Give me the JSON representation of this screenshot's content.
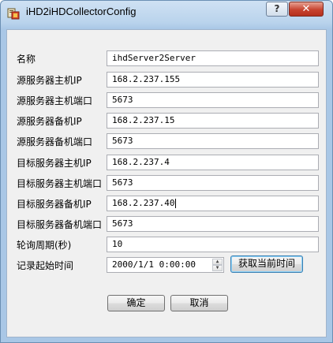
{
  "window": {
    "title": "iHD2iHDCollectorConfig",
    "help_label": "?",
    "close_label": "✕"
  },
  "form": {
    "name": {
      "label": "名称",
      "value": "ihdServer2Server"
    },
    "src_primary_ip": {
      "label": "源服务器主机IP",
      "value": "168.2.237.155"
    },
    "src_primary_port": {
      "label": "源服务器主机端口",
      "value": "5673"
    },
    "src_backup_ip": {
      "label": "源服务器备机IP",
      "value": "168.2.237.15"
    },
    "src_backup_port": {
      "label": "源服务器备机端口",
      "value": "5673"
    },
    "dst_primary_ip": {
      "label": "目标服务器主机IP",
      "value": "168.2.237.4"
    },
    "dst_primary_port": {
      "label": "目标服务器主机端口",
      "value": "5673"
    },
    "dst_backup_ip": {
      "label": "目标服务器备机IP",
      "value": "168.2.237.40"
    },
    "dst_backup_port": {
      "label": "目标服务器备机端口",
      "value": "5673"
    },
    "poll_period": {
      "label": "轮询周期(秒)",
      "value": "10"
    },
    "record_start": {
      "label": "记录起始时间",
      "value": "2000/1/1 0:00:00"
    }
  },
  "buttons": {
    "get_current_time": "获取当前时间",
    "ok": "确定",
    "cancel": "取消"
  }
}
